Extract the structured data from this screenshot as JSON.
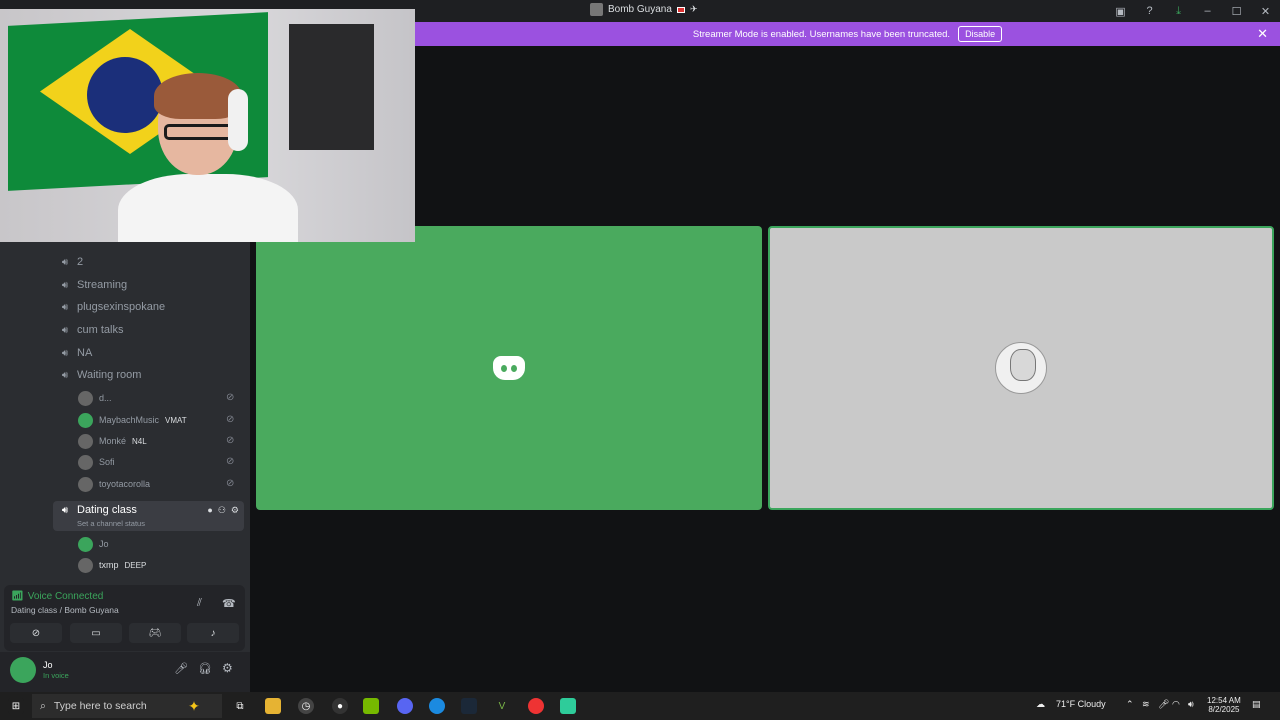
{
  "window": {
    "title": "Bomb Guyana"
  },
  "banner": {
    "message": "Streamer Mode is enabled. Usernames have been truncated.",
    "disable_label": "Disable",
    "color": "#9b51e0"
  },
  "channels": [
    {
      "name": "2"
    },
    {
      "name": "Streaming"
    },
    {
      "name": "plugsexinspokane"
    },
    {
      "name": "cum talks"
    },
    {
      "name": "NA"
    },
    {
      "name": "Waiting room"
    }
  ],
  "waiting_members": [
    {
      "name": "d...",
      "tag": ""
    },
    {
      "name": "MaybachMusic",
      "tag": "VMAT"
    },
    {
      "name": "Monké",
      "tag": "N4L"
    },
    {
      "name": "Sofi",
      "tag": ""
    },
    {
      "name": "toyotacorolla",
      "tag": ""
    }
  ],
  "active_channel": {
    "name": "Dating class",
    "status": "Set a channel status"
  },
  "active_members": [
    {
      "name": "Jo",
      "tag": ""
    },
    {
      "name": "txmp",
      "tag": "DEEP"
    }
  ],
  "voice": {
    "status": "Voice Connected",
    "location": "Dating class / Bomb Guyana"
  },
  "user": {
    "name": "Jo",
    "status": "In voice"
  },
  "taskbar": {
    "search_placeholder": "Type here to search",
    "weather": "71°F  Cloudy",
    "time": "12:54 AM",
    "date": "8/2/2025"
  },
  "colors": {
    "accent_green": "#3ba55c",
    "tile_green": "#4aaa5e"
  }
}
